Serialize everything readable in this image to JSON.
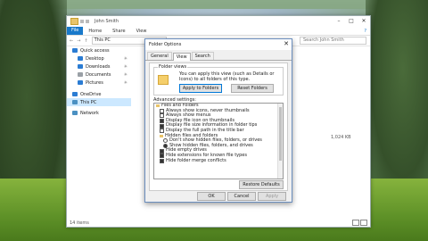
{
  "explorer": {
    "title": "John Smith",
    "ribbon_tabs": [
      "File",
      "Home",
      "Share",
      "View"
    ],
    "address": "This PC",
    "search_placeholder": "Search John Smith",
    "sidebar": [
      {
        "label": "Quick access",
        "icon": "star-icon",
        "color": "#2b7cd3",
        "pinned": false,
        "indent": false,
        "selected": false
      },
      {
        "label": "Desktop",
        "icon": "desktop-icon",
        "color": "#2b7cd3",
        "pinned": true,
        "indent": true,
        "selected": false
      },
      {
        "label": "Downloads",
        "icon": "download-icon",
        "color": "#2b7cd3",
        "pinned": true,
        "indent": true,
        "selected": false
      },
      {
        "label": "Documents",
        "icon": "documents-icon",
        "color": "#9aa0a6",
        "pinned": true,
        "indent": true,
        "selected": false
      },
      {
        "label": "Pictures",
        "icon": "pictures-icon",
        "color": "#2b7cd3",
        "pinned": true,
        "indent": true,
        "selected": false
      },
      {
        "label": "OneDrive",
        "icon": "cloud-icon",
        "color": "#2b7cd3",
        "pinned": false,
        "indent": false,
        "selected": false
      },
      {
        "label": "This PC",
        "icon": "computer-icon",
        "color": "#4a90c2",
        "pinned": false,
        "indent": false,
        "selected": true
      },
      {
        "label": "Network",
        "icon": "network-icon",
        "color": "#4a90c2",
        "pinned": false,
        "indent": false,
        "selected": false
      }
    ],
    "file_types": [
      "folder",
      "folder",
      "folder",
      "folder",
      "folder",
      "folder",
      "folder",
      "folder",
      "folder",
      "folder",
      "folder",
      "folder"
    ],
    "file_size": "1,024 KB",
    "status": "14 items"
  },
  "dialog": {
    "title": "Folder Options",
    "tabs": [
      "General",
      "View",
      "Search"
    ],
    "folder_views_label": "Folder views",
    "folder_views_desc": "You can apply this view (such as Details or Icons) to all folders of this type.",
    "apply_button": "Apply to Folders",
    "reset_button": "Reset Folders",
    "advanced_label": "Advanced settings:",
    "advanced_items": [
      {
        "label": "Files and Folders",
        "kind": "folder",
        "level": 0,
        "checked": false
      },
      {
        "label": "Always show icons, never thumbnails",
        "kind": "check",
        "level": 1,
        "checked": false
      },
      {
        "label": "Always show menus",
        "kind": "check",
        "level": 1,
        "checked": false
      },
      {
        "label": "Display file icon on thumbnails",
        "kind": "check",
        "level": 1,
        "checked": true
      },
      {
        "label": "Display file size information in folder tips",
        "kind": "check",
        "level": 1,
        "checked": true
      },
      {
        "label": "Display the full path in the title bar",
        "kind": "check",
        "level": 1,
        "checked": false
      },
      {
        "label": "Hidden files and folders",
        "kind": "folder",
        "level": 1,
        "checked": false
      },
      {
        "label": "Don't show hidden files, folders, or drives",
        "kind": "radio",
        "level": 2,
        "checked": false
      },
      {
        "label": "Show hidden files, folders, and drives",
        "kind": "radio",
        "level": 2,
        "checked": true
      },
      {
        "label": "Hide empty drives",
        "kind": "check",
        "level": 1,
        "checked": true
      },
      {
        "label": "Hide extensions for known file types",
        "kind": "check",
        "level": 1,
        "checked": true
      },
      {
        "label": "Hide folder merge conflicts",
        "kind": "check",
        "level": 1,
        "checked": true
      }
    ],
    "restore_button": "Restore Defaults",
    "ok_button": "OK",
    "cancel_button": "Cancel",
    "apply_disabled_button": "Apply"
  }
}
